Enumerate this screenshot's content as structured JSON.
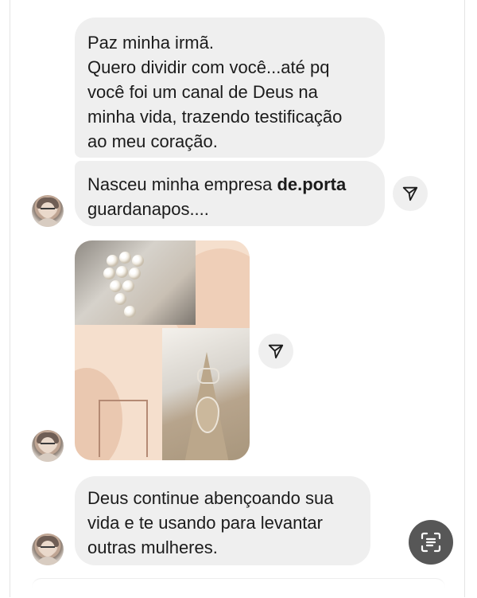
{
  "messages": [
    {
      "id": "m1",
      "lines": [
        "Paz minha irmã.",
        "Quero dividir com você...até pq",
        "você foi um canal de Deus na",
        "minha vida, trazendo testificação",
        "ao meu coração."
      ]
    },
    {
      "id": "m2",
      "prefix": "Nasceu minha empresa ",
      "bold": "de.porta",
      "line2": "guardanapos...."
    },
    {
      "id": "m3",
      "type": "image",
      "image_icon": "photo-collage-napkin-rings"
    },
    {
      "id": "m4",
      "lines": [
        "Deus continue abençoando sua",
        "vida e te usando para levantar",
        "outras mulheres."
      ]
    }
  ],
  "icons": {
    "share": "paper-plane-icon",
    "scan": "text-scan-icon",
    "avatar": "contact-avatar"
  },
  "colors": {
    "bubble": "#efefef",
    "scan_button": "#575757",
    "text": "#1b1b1b"
  }
}
